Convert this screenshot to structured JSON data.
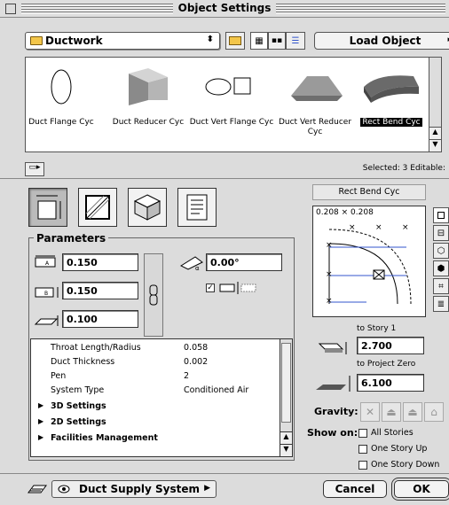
{
  "window": {
    "title": "Object Settings"
  },
  "toolbar": {
    "library_popup": "Ductwork",
    "load_object": "Load Object"
  },
  "library_objects": [
    {
      "name": "Duct Flange Cyc",
      "selected": false
    },
    {
      "name": "Duct Reducer Cyc",
      "selected": false
    },
    {
      "name": "Duct Vert Flange Cyc",
      "selected": false
    },
    {
      "name": "Duct Vert Reducer Cyc",
      "selected": false
    },
    {
      "name": "Rect Bend Cyc",
      "selected": true
    }
  ],
  "status": {
    "selected_info": "Selected: 3 Editable:"
  },
  "parameters": {
    "title": "Parameters",
    "width_a": "0.150",
    "width_b": "0.150",
    "height": "0.100",
    "angle": "0.00°"
  },
  "param_list": [
    {
      "key": "Throat Length/Radius",
      "value": "0.058"
    },
    {
      "key": "Duct Thickness",
      "value": "0.002"
    },
    {
      "key": "Pen",
      "value": "2"
    },
    {
      "key": "System Type",
      "value": "Conditioned Air"
    }
  ],
  "param_sections": [
    "3D Settings",
    "2D Settings",
    "Facilities Management"
  ],
  "preview": {
    "object_name": "Rect Bend Cyc",
    "dimension_text": "0.208 × 0.208"
  },
  "elevation": {
    "to_story_label": "to Story 1",
    "to_story_value": "2.700",
    "to_project_zero_label": "to Project Zero",
    "to_project_zero_value": "6.100"
  },
  "gravity": {
    "label": "Gravity:"
  },
  "show_on": {
    "label": "Show on:",
    "options": [
      "All Stories",
      "One Story Up",
      "One Story Down"
    ]
  },
  "footer": {
    "layer": "Duct Supply System",
    "cancel": "Cancel",
    "ok": "OK"
  },
  "colors": {
    "accent_line": "#3355cc",
    "selection_bg": "#000000"
  }
}
